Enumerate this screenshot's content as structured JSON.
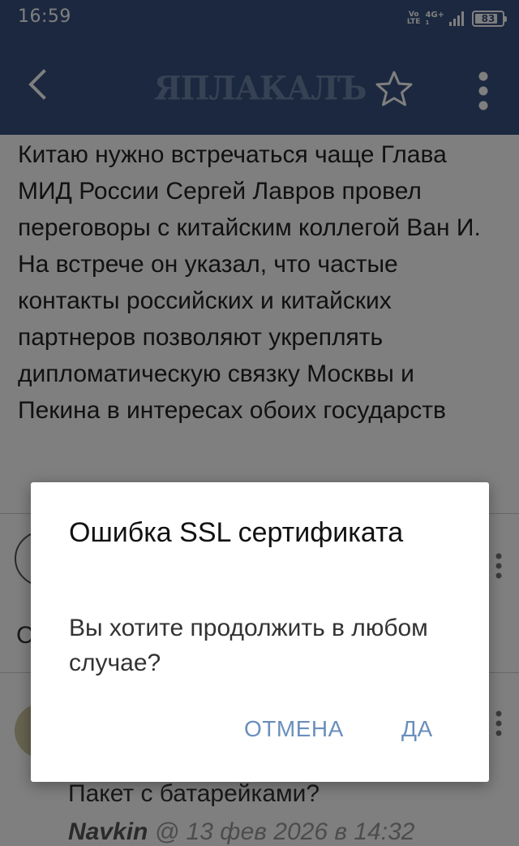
{
  "status_bar": {
    "time": "16:59",
    "volte_top": "Vo",
    "volte_bottom": "LTE",
    "network": "4G+",
    "network_sub": "1",
    "battery": 83
  },
  "app_bar": {
    "logo_text": "ЯПЛАКАЛЪ",
    "icons": [
      "back-arrow-icon",
      "star-icon",
      "more-vertical-icon"
    ]
  },
  "article": {
    "text": "Китаю нужно встречаться чаще Глава МИД России Сергей Лавров провел переговоры с китайским коллегой Ван И. На встрече он указал, что частые контакты российских и китайских партнеров позволяют укреплять дипломатическую связку Москвы и Пекина в интересах обоих государств"
  },
  "comments": {
    "fragment_1": "С",
    "text_2": "Пакет с батарейками?",
    "author_2": "Navkin",
    "date_2": " @ 13 фев 2026 в 14:32"
  },
  "dialog": {
    "title": "Ошибка SSL сертификата",
    "message": "Вы хотите продолжить в любом случае?",
    "cancel_label": "ОТМЕНА",
    "ok_label": "ДА"
  },
  "colors": {
    "app_bar": "#37517f",
    "dialog_button": "#6a8fbd"
  }
}
